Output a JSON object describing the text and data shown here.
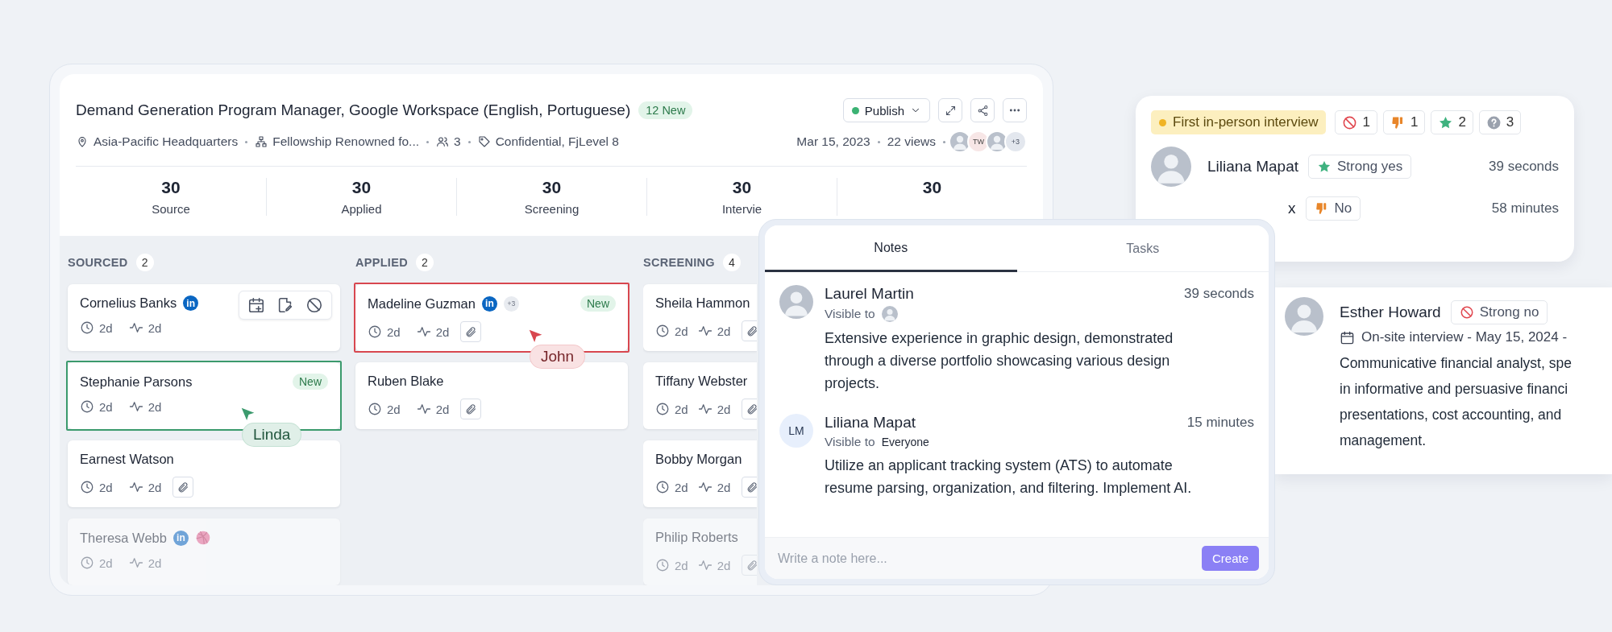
{
  "job": {
    "title": "Demand Generation Program Manager, Google Workspace (English, Portuguese)",
    "new_badge": "12 New",
    "publish": {
      "label": "Publish"
    },
    "meta": [
      {
        "kind": "location",
        "text": "Asia-Pacific Headquarters"
      },
      {
        "kind": "org",
        "text": "Fellowship Renowned fo..."
      },
      {
        "kind": "people",
        "text": "3"
      },
      {
        "kind": "tag",
        "text": "Confidential, FjLevel 8"
      }
    ],
    "date": "Mar 15, 2023",
    "views": "22 views",
    "viewers": [
      {
        "kind": "photo"
      },
      {
        "kind": "initials",
        "text": "TW"
      },
      {
        "kind": "photo"
      },
      {
        "kind": "more",
        "text": "+3"
      }
    ]
  },
  "stats": [
    {
      "value": "30",
      "label": "Source"
    },
    {
      "value": "30",
      "label": "Applied"
    },
    {
      "value": "30",
      "label": "Screening"
    },
    {
      "value": "30",
      "label": "Intervie"
    },
    {
      "value": "30"
    }
  ],
  "columns": [
    {
      "title": "SOURCED",
      "count": "2",
      "cards": [
        {
          "name": "Cornelius Banks",
          "social": [
            {
              "kind": "linkedin",
              "label": "in"
            }
          ],
          "time": "2d",
          "activity": "2d",
          "attachment": false,
          "actions": true,
          "faded": false
        },
        {
          "name": "Stephanie Parsons",
          "new_badge": "New",
          "time": "2d",
          "activity": "2d",
          "attachment": false,
          "actions": false,
          "faded": false,
          "cursor": {
            "name": "Linda",
            "color": "#3b9a6d"
          }
        },
        {
          "name": "Earnest Watson",
          "time": "2d",
          "activity": "2d",
          "attachment": true,
          "actions": false,
          "faded": false
        },
        {
          "name": "Theresa Webb",
          "social": [
            {
              "kind": "linkedin",
              "label": "in"
            },
            {
              "kind": "dribbble"
            }
          ],
          "time": "2d",
          "activity": "2d",
          "attachment": false,
          "actions": false,
          "faded": true
        }
      ]
    },
    {
      "title": "APPLIED",
      "count": "2",
      "cards": [
        {
          "name": "Madeline Guzman",
          "social": [
            {
              "kind": "linkedin",
              "label": "in"
            }
          ],
          "extra": "+3",
          "new_badge": "New",
          "time": "2d",
          "activity": "2d",
          "attachment": true,
          "actions": false,
          "faded": false,
          "cursor": {
            "name": "John",
            "color": "#d8474f"
          }
        },
        {
          "name": "Ruben Blake",
          "time": "2d",
          "activity": "2d",
          "attachment": true,
          "actions": false,
          "faded": false
        }
      ]
    },
    {
      "title": "SCREENING",
      "count": "4",
      "cards": [
        {
          "name": "Sheila Hammon",
          "time": "2d",
          "activity": "2d",
          "attachment": true,
          "actions": false,
          "faded": false
        },
        {
          "name": "Tiffany Webster",
          "time": "2d",
          "activity": "2d",
          "attachment": true,
          "actions": false,
          "faded": false
        },
        {
          "name": "Bobby Morgan",
          "time": "2d",
          "activity": "2d",
          "attachment": true,
          "actions": false,
          "faded": false
        },
        {
          "name": "Philip Roberts",
          "time": "2d",
          "activity": "2d",
          "attachment": true,
          "actions": false,
          "faded": true
        }
      ]
    }
  ],
  "notes": {
    "tabs": [
      {
        "label": "Notes",
        "selected": true
      },
      {
        "label": "Tasks",
        "selected": false
      }
    ],
    "entries": [
      {
        "author": "Laurel Martin",
        "avatar": {
          "kind": "photo"
        },
        "time": "39 seconds",
        "visible_label": "Visible to",
        "visible_to": {
          "kind": "photo"
        },
        "text": "Extensive experience in graphic design, demonstrated through a diverse portfolio showcasing various design projects."
      },
      {
        "author": "Liliana Mapat",
        "avatar": {
          "kind": "initials",
          "text": "LM"
        },
        "time": "15 minutes",
        "visible_label": "Visible to",
        "visible_to": {
          "kind": "text",
          "text": "Everyone"
        },
        "text": "Utilize an applicant tracking system (ATS) to automate resume parsing, organization, and filtering. Implement AI."
      }
    ],
    "composer": {
      "placeholder": "Write a note here...",
      "button": "Create"
    }
  },
  "feedback": {
    "stage": {
      "label": "First in-person interview",
      "color": "#f0b323"
    },
    "tallies": [
      {
        "kind": "strong-no",
        "count": "1"
      },
      {
        "kind": "no",
        "count": "1"
      },
      {
        "kind": "strong-yes",
        "count": "2"
      },
      {
        "kind": "unsure",
        "count": "3"
      }
    ],
    "reviews": [
      {
        "name": "Liliana Mapat",
        "avatar": true,
        "verdict": {
          "kind": "strong-yes",
          "label": "Strong yes"
        },
        "time": "39 seconds"
      },
      {
        "name": "x",
        "avatar": false,
        "verdict": {
          "kind": "no",
          "label": "No"
        },
        "time": "58 minutes"
      }
    ]
  },
  "review_card": {
    "name": "Esther Howard",
    "verdict": {
      "kind": "strong-no",
      "label": "Strong no"
    },
    "event": "On-site interview - May 15, 2024 -",
    "text_lines": [
      "Communicative financial analyst, spe",
      "in informative and persuasive financi",
      "presentations, cost accounting, and",
      "management."
    ]
  }
}
